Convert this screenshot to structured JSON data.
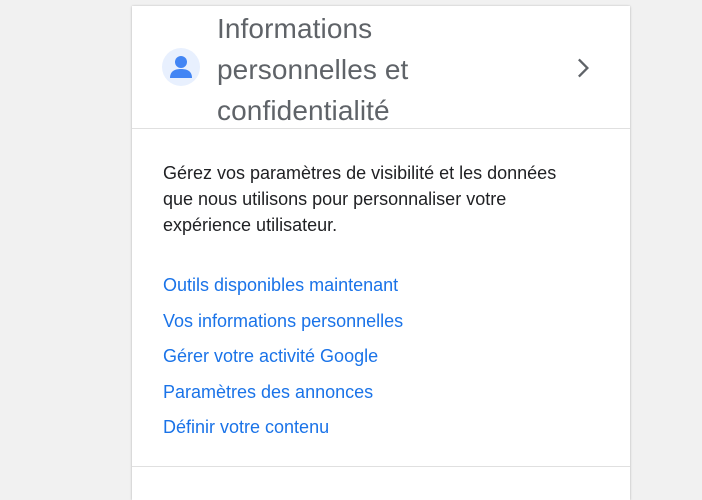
{
  "card": {
    "title_lines": [
      "Informations",
      "personnelles et",
      "confidentialité"
    ],
    "icons": {
      "avatar": "person-avatar-icon",
      "chevron": "chevron-right-icon"
    },
    "description_lines": [
      "Gérez vos paramètres de visibilité et les données",
      "que nous utilisons pour personnaliser votre",
      "expérience utilisateur."
    ],
    "links": [
      "Outils disponibles maintenant",
      "Vos informations personnelles",
      "Gérer votre activité Google",
      "Paramètres des annonces",
      "Définir votre contenu"
    ]
  },
  "colors": {
    "link": "#1a73e8",
    "avatar_bg": "#e8f0fe",
    "avatar_fg": "#4285f4",
    "title": "#5f6368"
  }
}
